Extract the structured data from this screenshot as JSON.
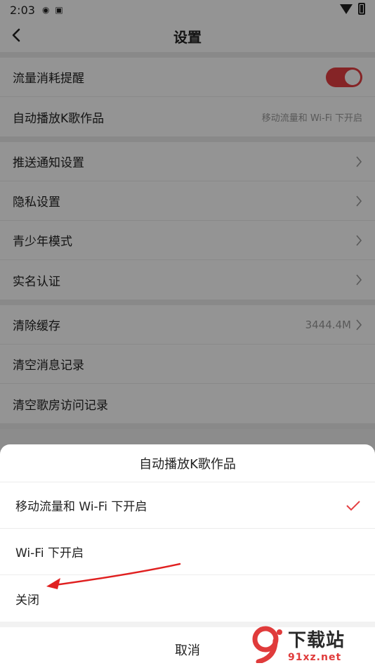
{
  "status_bar": {
    "time": "2:03"
  },
  "header": {
    "title": "设置"
  },
  "groups": [
    {
      "items": [
        {
          "label": "流量消耗提醒",
          "control": "toggle",
          "toggle_on": true
        },
        {
          "label": "自动播放K歌作品",
          "value": "移动流量和 Wi-Fi 下开启"
        }
      ]
    },
    {
      "items": [
        {
          "label": "推送通知设置"
        },
        {
          "label": "隐私设置"
        },
        {
          "label": "青少年模式"
        },
        {
          "label": "实名认证"
        }
      ]
    },
    {
      "items": [
        {
          "label": "清除缓存",
          "value": "3444.4M"
        },
        {
          "label": "清空消息记录"
        },
        {
          "label": "清空歌房访问记录"
        }
      ]
    }
  ],
  "sheet": {
    "title": "自动播放K歌作品",
    "options": [
      {
        "label": "移动流量和 Wi-Fi 下开启",
        "selected": true
      },
      {
        "label": "Wi-Fi 下开启",
        "selected": false
      },
      {
        "label": "关闭",
        "selected": false
      }
    ],
    "cancel_label": "取消"
  },
  "watermark": {
    "name": "下载站",
    "url": "91xz.net",
    "logo": "9"
  },
  "colors": {
    "accent": "#e53f42",
    "overlay": "rgba(0,0,0,0.42)"
  }
}
